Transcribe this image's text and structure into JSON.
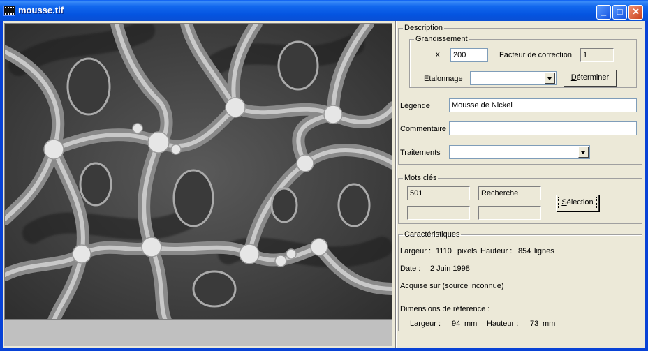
{
  "window": {
    "title": "mousse.tif",
    "min_glyph": "_",
    "max_glyph": "□",
    "close_glyph": "✕"
  },
  "description": {
    "legend": "Description",
    "grandissement": {
      "legend": "Grandissement",
      "x_label": "X",
      "x_value": "200",
      "facteur_label": "Facteur de correction",
      "facteur_value": "1",
      "etalonnage_label": "Etalonnage",
      "etalonnage_value": "",
      "determiner_first": "D",
      "determiner_rest": "éterminer"
    },
    "legende_label": "Légende",
    "legende_value": "Mousse de Nickel",
    "commentaire_label": "Commentaire",
    "commentaire_value": "",
    "traitements_label": "Traitements",
    "traitements_value": ""
  },
  "mots_cles": {
    "legend": "Mots clés",
    "fields": [
      "501",
      "Recherche",
      "",
      ""
    ],
    "selection_first": "S",
    "selection_rest": "élection"
  },
  "caracteristiques": {
    "legend": "Caractéristiques",
    "largeur_label": "Largeur :",
    "largeur_value": "1110",
    "largeur_unit": "pixels",
    "hauteur_label": "Hauteur :",
    "hauteur_value": "854",
    "hauteur_unit": "lignes",
    "date_label": "Date :",
    "date_value": "2 Juin 1998",
    "acquise": "Acquise sur (source inconnue)",
    "dimensions_label": "Dimensions de référence :",
    "ref_largeur_label": "Largeur :",
    "ref_largeur_value": "94",
    "ref_largeur_unit": "mm",
    "ref_hauteur_label": "Hauteur :",
    "ref_hauteur_value": "73",
    "ref_hauteur_unit": "mm"
  },
  "colors": {
    "titlebar": "#0a5df2",
    "window_bg": "#ece9d8",
    "close_button": "#c8401c"
  }
}
